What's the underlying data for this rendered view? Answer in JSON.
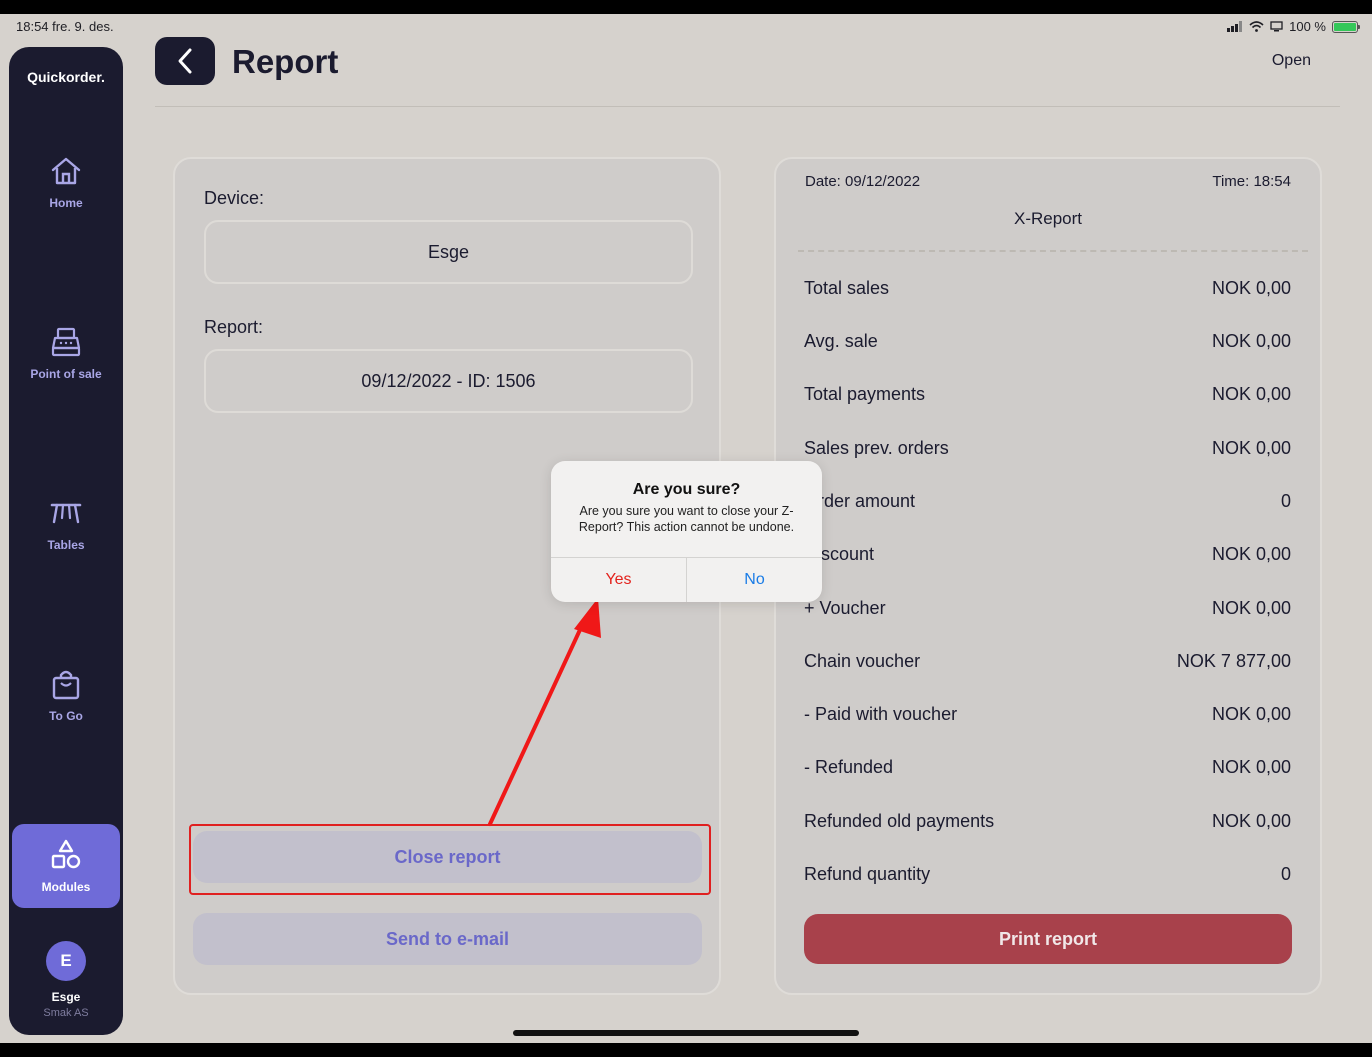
{
  "status_bar": {
    "time_date": "18:54  fre. 9. des.",
    "battery_text": "100 %"
  },
  "sidebar": {
    "brand": "Quickorder.",
    "items": [
      {
        "label": "Home",
        "icon": "home-icon"
      },
      {
        "label": "Point of sale",
        "icon": "cash-register-icon"
      },
      {
        "label": "Tables",
        "icon": "table-icon"
      },
      {
        "label": "To Go",
        "icon": "shopping-bag-icon"
      },
      {
        "label": "Modules",
        "icon": "shapes-icon",
        "active": true
      }
    ],
    "user": {
      "initial": "E",
      "name": "Esge",
      "org": "Smak AS"
    }
  },
  "header": {
    "title": "Report",
    "status": "Open"
  },
  "left_panel": {
    "device_label": "Device:",
    "device_value": "Esge",
    "report_label": "Report:",
    "report_value": "09/12/2022 - ID: 1506",
    "close_button": "Close report",
    "email_button": "Send to e-mail"
  },
  "report": {
    "date": "Date: 09/12/2022",
    "time": "Time: 18:54",
    "type": "X-Report",
    "rows": [
      {
        "label": "Total sales",
        "value": "NOK 0,00"
      },
      {
        "label": "Avg. sale",
        "value": "NOK 0,00"
      },
      {
        "label": "Total payments",
        "value": "NOK 0,00"
      },
      {
        "label": "Sales prev. orders",
        "value": "NOK 0,00"
      },
      {
        "label": "Order amount",
        "value": "0"
      },
      {
        "label": "Discount",
        "value": "NOK 0,00"
      },
      {
        "label": "+ Voucher",
        "value": "NOK 0,00"
      },
      {
        "label": "Chain voucher",
        "value": "NOK 7 877,00"
      },
      {
        "label": "- Paid with voucher",
        "value": "NOK 0,00"
      },
      {
        "label": "- Refunded",
        "value": "NOK 0,00"
      },
      {
        "label": "Refunded old payments",
        "value": "NOK 0,00"
      },
      {
        "label": "Refund quantity",
        "value": "0"
      }
    ],
    "print_button": "Print report"
  },
  "dialog": {
    "title": "Are you sure?",
    "message": "Are you sure you want to close your Z-Report? This action cannot be undone.",
    "yes": "Yes",
    "no": "No"
  },
  "colors": {
    "accent": "#6f6bd8",
    "sidebar": "#1b1b2f",
    "danger": "#a8414b",
    "highlight": "#e02020"
  }
}
